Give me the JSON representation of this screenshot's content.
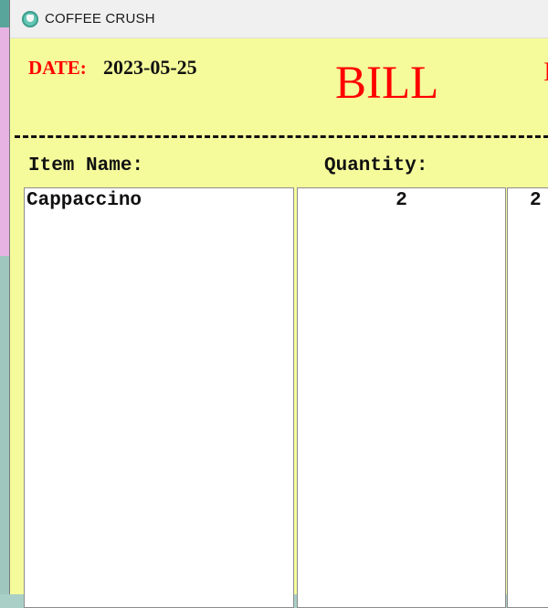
{
  "window": {
    "title": "COFFEE CRUSH",
    "icon": "coffee-cup-icon"
  },
  "bill": {
    "date_label": "DATE:",
    "date_value": "2023-05-25",
    "heading": "BILL",
    "separator": "-------------------------------------------------------",
    "columns": {
      "item_name": "Item Name:",
      "quantity": "Quantity:"
    },
    "items": [
      {
        "name": "Cappaccino",
        "quantity": "2",
        "price": "2"
      }
    ]
  },
  "colors": {
    "background": "#f5fb9b",
    "accent": "#ff0000",
    "text": "#111111"
  }
}
